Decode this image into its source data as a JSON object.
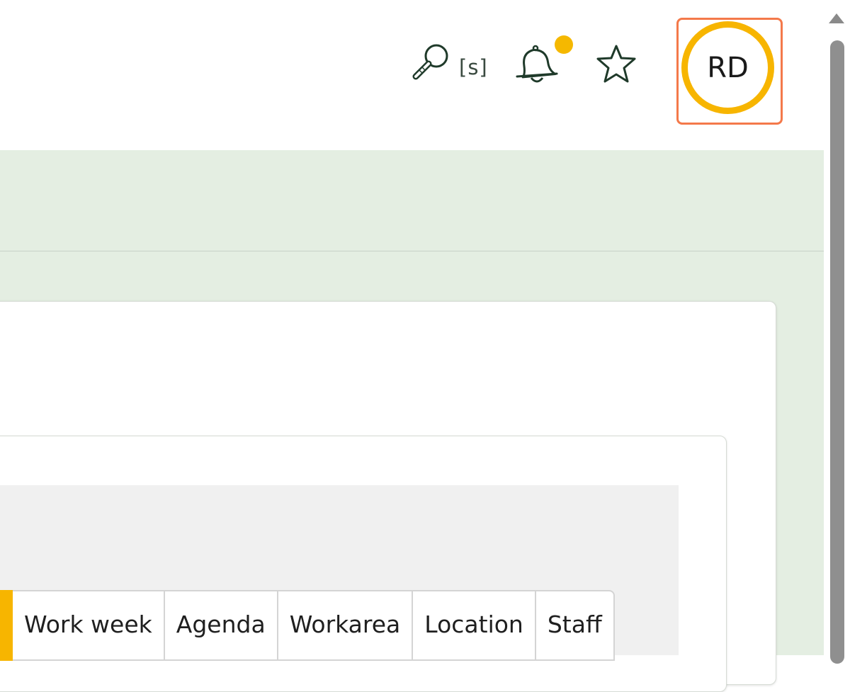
{
  "header": {
    "search": {
      "icon": "search-icon",
      "shortcut_hint": "[s]"
    },
    "notifications": {
      "icon": "bell-icon",
      "has_unread": true,
      "dot_color": "#f5b800"
    },
    "favorites": {
      "icon": "star-icon"
    },
    "user": {
      "initials": "RD",
      "ring_color": "#f7b500",
      "highlight_color": "#f4794a"
    }
  },
  "calendar": {
    "view_tabs": [
      {
        "label": "Work week"
      },
      {
        "label": "Agenda"
      },
      {
        "label": "Workarea"
      },
      {
        "label": "Location"
      },
      {
        "label": "Staff"
      }
    ]
  },
  "colors": {
    "content_background": "#e4eee2",
    "accent": "#f7b500"
  }
}
